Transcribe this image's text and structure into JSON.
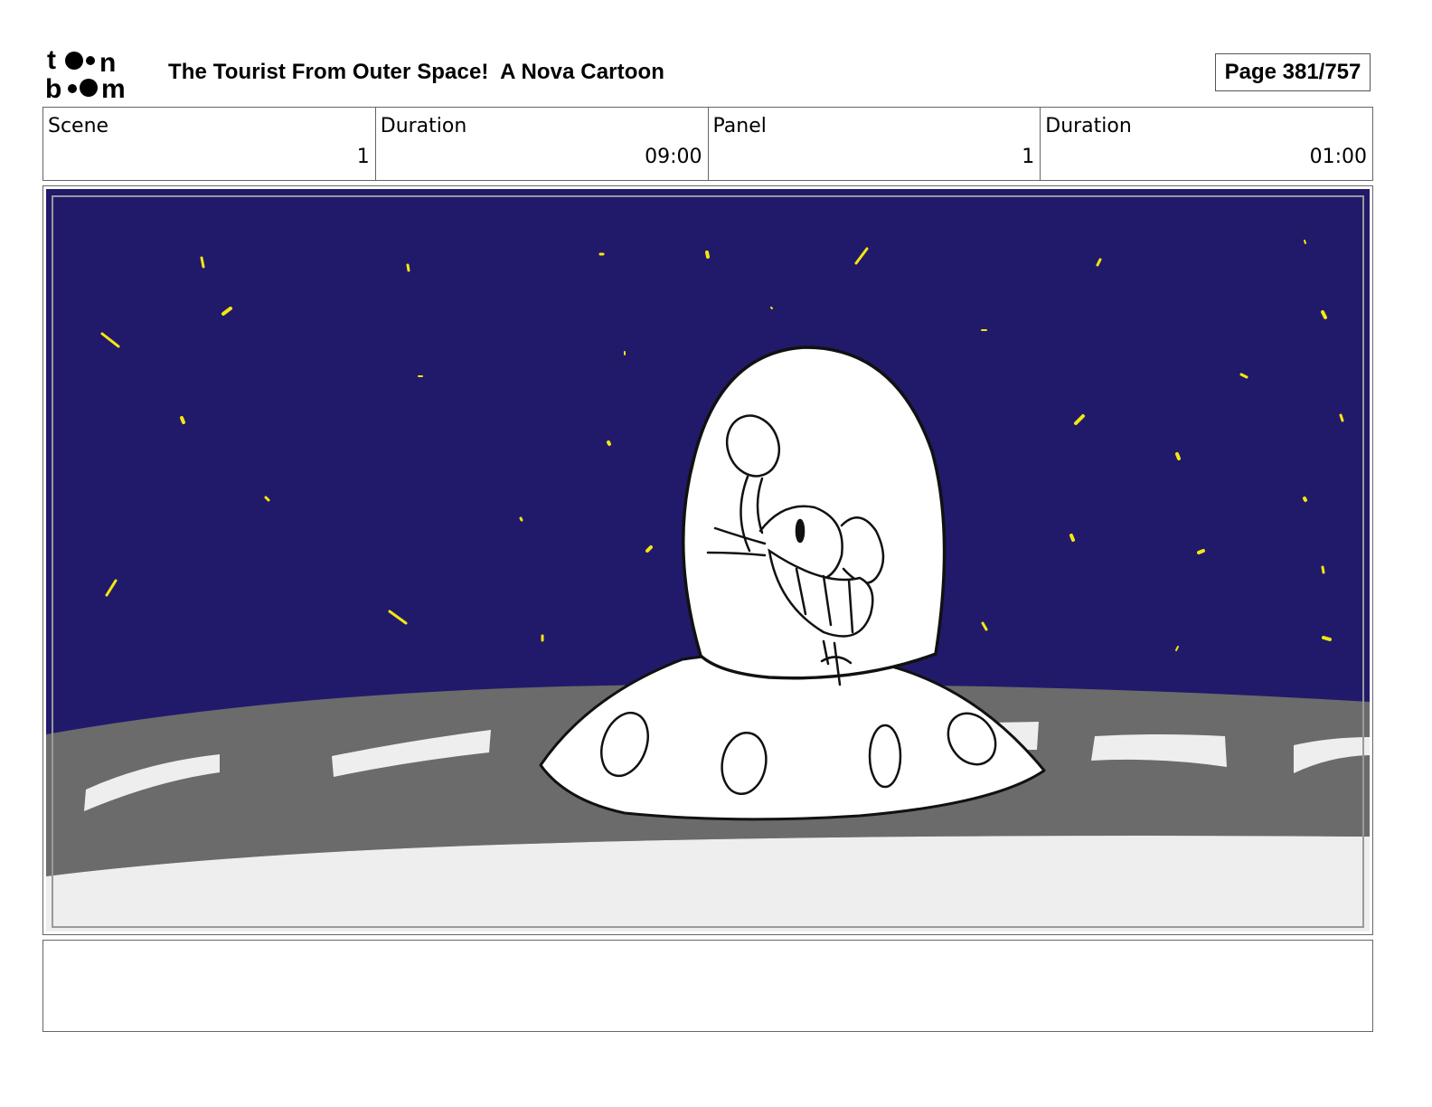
{
  "header": {
    "logo_alt": "toon boom",
    "title": "The Tourist From Outer Space!  A Nova Cartoon",
    "page_label": "Page 381/757"
  },
  "info": {
    "scene_label": "Scene",
    "scene_value": "1",
    "scene_duration_label": "Duration",
    "scene_duration_value": "09:00",
    "panel_label": "Panel",
    "panel_value": "1",
    "panel_duration_label": "Duration",
    "panel_duration_value": "01:00"
  },
  "panel": {
    "sky_color": "#211a6b",
    "star_color": "#f5e70f",
    "road_color": "#6b6b6b",
    "ground_color": "#eeeeee"
  },
  "notes": {
    "text": ""
  }
}
